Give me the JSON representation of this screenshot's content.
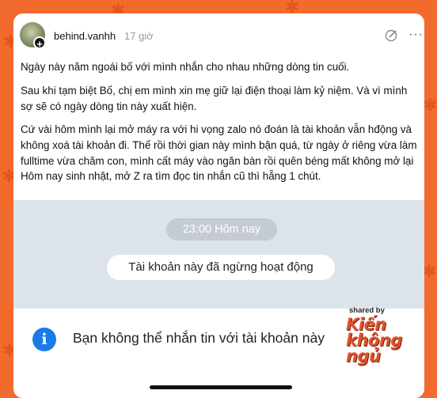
{
  "post": {
    "username": "behind.vanhh",
    "time": "17 giờ",
    "paragraphs": [
      "Ngày này năm ngoái bố với mình nhắn cho nhau những dòng tin cuối.",
      "Sau khi tạm biệt Bố, chị em mình xin mẹ giữ lại điện thoại làm kỷ niệm. Và vì mình sợ sẽ có ngày dòng tin này xuất hiện.",
      "Cứ vài hôm mình lại mở máy ra với hi vọng zalo nó đoán là tài khoản vẫn hđộng và không xoá tài khoản đi. Thế rồi thời gian này mình bận quá, từ ngày ở riêng vừa làm fulltime vừa chăm con, mình cất máy vào ngăn bàn rồi quên béng mất không mở lại",
      "Hôm nay sinh nhật, mở Z ra tìm đọc tin nhắn cũ thì hẵng 1 chút."
    ]
  },
  "chat": {
    "time_label": "23:00 Hôm nay",
    "status_label": "Tài khoản này đã ngừng hoạt động",
    "notice_text": "Bạn không thể nhắn tin với tài khoản này"
  },
  "watermark": {
    "shared_by": "shared by",
    "brand_line1": "Kiến",
    "brand_line2": "không",
    "brand_line3": "ngủ"
  },
  "colors": {
    "background": "#f26b2e",
    "info_icon": "#1a7be6",
    "chat_background": "#dde3ea"
  },
  "icons": [
    "ant-pattern",
    "plus-icon",
    "edit-icon",
    "more-icon",
    "info-icon"
  ]
}
